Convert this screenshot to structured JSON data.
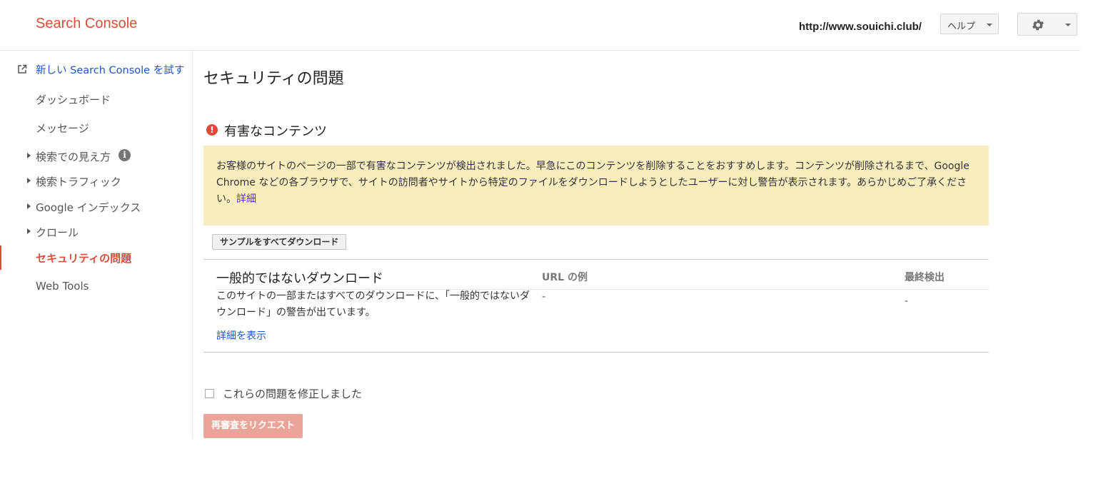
{
  "header": {
    "logo": "Search Console",
    "site_url": "http://www.souichi.club/",
    "help_label": "ヘルプ",
    "settings_icon": "gear-icon"
  },
  "sidebar": {
    "new_console_link": "新しい Search Console を試す",
    "items": [
      {
        "label": "ダッシュボード"
      },
      {
        "label": "メッセージ"
      },
      {
        "label": "検索での見え方"
      },
      {
        "label": "検索トラフィック"
      },
      {
        "label": "Google インデックス"
      },
      {
        "label": "クロール"
      },
      {
        "label": "セキュリティの問題",
        "active": true
      },
      {
        "label": "Web Tools"
      }
    ],
    "info_icon_char": "i"
  },
  "main": {
    "page_title": "セキュリティの問題",
    "section_title": "有害なコンテンツ",
    "warning_icon_char": "!",
    "alert_text": "お客様のサイトのページの一部で有害なコンテンツが検出されました。早急にこのコンテンツを削除することをおすすめします。コンテンツが削除されるまで、Google Chrome などの各ブラウザで、サイトの訪問者やサイトから特定のファイルをダウンロードしようとしたユーザーに対し警告が表示されます。あらかじめご了承ください。",
    "alert_link": "詳細",
    "download_all_label": "サンプルをすべてダウンロード",
    "table": {
      "issue_title": "一般的ではないダウンロード",
      "col_url": "URL の例",
      "col_last": "最終検出",
      "issue_desc": "このサイトの一部またはすべてのダウンロードに、「一般的ではないダウンロード」の警告が出ています。",
      "url_value": "-",
      "last_value": "-",
      "details_link": "詳細を表示"
    },
    "fixed_label": "これらの問題を修正しました",
    "review_button": "再審査をリクエスト"
  },
  "colors": {
    "brand_red": "#dd4b39",
    "alert_bg": "#f9edbe",
    "link_blue": "#1a56c7",
    "disabled_button": "#eaa59b"
  }
}
